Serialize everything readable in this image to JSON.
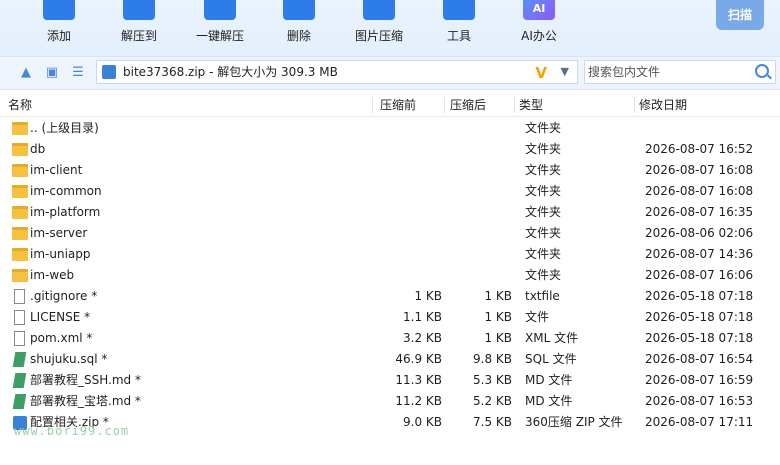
{
  "toolbar": {
    "items": [
      {
        "label": "添加",
        "icon": "add-icon"
      },
      {
        "label": "解压到",
        "icon": "extract-to-icon"
      },
      {
        "label": "一键解压",
        "icon": "one-click-extract-icon"
      },
      {
        "label": "删除",
        "icon": "delete-icon"
      },
      {
        "label": "图片压缩",
        "icon": "image-compress-icon"
      },
      {
        "label": "工具",
        "icon": "tools-icon"
      },
      {
        "label": "AI办公",
        "icon": "ai-office-icon",
        "badge": "AI"
      }
    ],
    "scan_label": "扫描"
  },
  "address": {
    "path_text": "bite37368.zip - 解包大小为 309.3 MB",
    "v_badge": "V",
    "search_placeholder": "搜索包内文件"
  },
  "columns": {
    "name": "名称",
    "compressed": "压缩前",
    "uncompressed": "压缩后",
    "type": "类型",
    "modified": "修改日期"
  },
  "rows": [
    {
      "name": ".. (上级目录)",
      "csize": "",
      "usize": "",
      "type": "文件夹",
      "date": "",
      "kind": "folder"
    },
    {
      "name": "db",
      "csize": "",
      "usize": "",
      "type": "文件夹",
      "date": "2026-08-07 16:52",
      "kind": "folder"
    },
    {
      "name": "im-client",
      "csize": "",
      "usize": "",
      "type": "文件夹",
      "date": "2026-08-07 16:08",
      "kind": "folder"
    },
    {
      "name": "im-common",
      "csize": "",
      "usize": "",
      "type": "文件夹",
      "date": "2026-08-07 16:08",
      "kind": "folder"
    },
    {
      "name": "im-platform",
      "csize": "",
      "usize": "",
      "type": "文件夹",
      "date": "2026-08-07 16:35",
      "kind": "folder"
    },
    {
      "name": "im-server",
      "csize": "",
      "usize": "",
      "type": "文件夹",
      "date": "2026-08-06 02:06",
      "kind": "folder"
    },
    {
      "name": "im-uniapp",
      "csize": "",
      "usize": "",
      "type": "文件夹",
      "date": "2026-08-07 14:36",
      "kind": "folder"
    },
    {
      "name": "im-web",
      "csize": "",
      "usize": "",
      "type": "文件夹",
      "date": "2026-08-07 16:06",
      "kind": "folder"
    },
    {
      "name": ".gitignore *",
      "csize": "1 KB",
      "usize": "1 KB",
      "type": "txtfile",
      "date": "2026-05-18 07:18",
      "kind": "file"
    },
    {
      "name": "LICENSE *",
      "csize": "1.1 KB",
      "usize": "1 KB",
      "type": "文件",
      "date": "2026-05-18 07:18",
      "kind": "file"
    },
    {
      "name": "pom.xml *",
      "csize": "3.2 KB",
      "usize": "1 KB",
      "type": "XML 文件",
      "date": "2026-05-18 07:18",
      "kind": "file"
    },
    {
      "name": "shujuku.sql *",
      "csize": "46.9 KB",
      "usize": "9.8 KB",
      "type": "SQL 文件",
      "date": "2026-08-07 16:54",
      "kind": "sql"
    },
    {
      "name": "部署教程_SSH.md *",
      "csize": "11.3 KB",
      "usize": "5.3 KB",
      "type": "MD 文件",
      "date": "2026-08-07 16:59",
      "kind": "sql"
    },
    {
      "name": "部署教程_宝塔.md *",
      "csize": "11.2 KB",
      "usize": "5.2 KB",
      "type": "MD 文件",
      "date": "2026-08-07 16:53",
      "kind": "sql"
    },
    {
      "name": "配置相关.zip *",
      "csize": "9.0 KB",
      "usize": "7.5 KB",
      "type": "360压缩 ZIP 文件",
      "date": "2026-08-07 17:11",
      "kind": "zip"
    }
  ],
  "watermark": "www.bori99.com",
  "colors": {
    "accent": "#2e7ce8",
    "folder": "#f6c13f",
    "toolbar_bg": "#eaf3fd"
  }
}
